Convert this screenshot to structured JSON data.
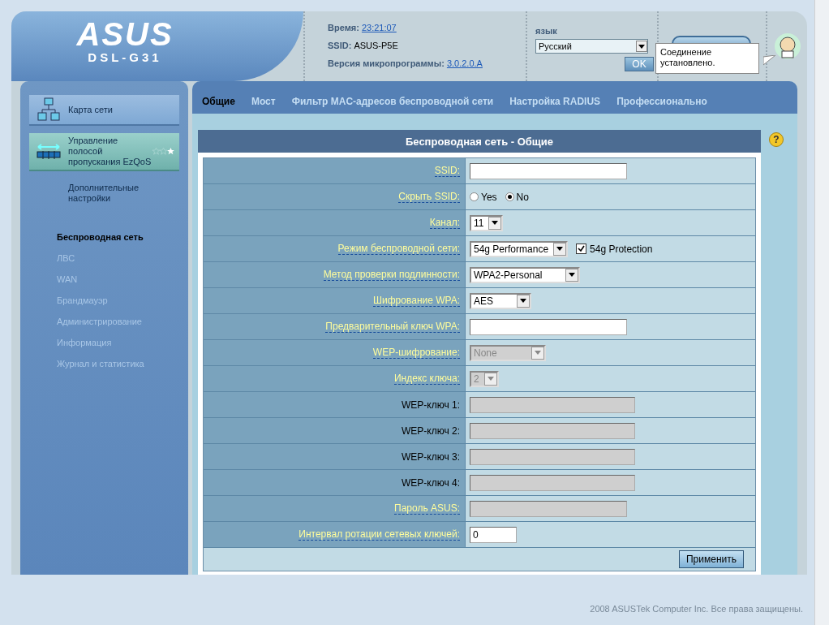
{
  "header": {
    "logo": "ASUS",
    "model": "DSL-G31",
    "time_label": "Время:",
    "time": "23:21:07",
    "ssid_label": "SSID:",
    "ssid": "ASUS-P5E",
    "firmware_label": "Версия микропрограммы:",
    "firmware": "3.0.2.0.A",
    "language_label": "язык",
    "language": "Русский",
    "ok_button": "OK",
    "status_tooltip": "Соединение установлено."
  },
  "sidebar": {
    "items": [
      {
        "label": "Карта сети",
        "kind": "network",
        "selected": false
      },
      {
        "label": "Управление полосой пропускания EzQoS",
        "kind": "qos",
        "selected": true,
        "stars": 1
      },
      {
        "label": "Дополнительные настройки",
        "kind": "plain",
        "selected": false
      }
    ],
    "submenu": [
      {
        "label": "Беспроводная сеть",
        "selected": true
      },
      {
        "label": "ЛВС",
        "selected": false
      },
      {
        "label": "WAN",
        "selected": false
      },
      {
        "label": "Брандмауэр",
        "selected": false
      },
      {
        "label": "Администрирование",
        "selected": false
      },
      {
        "label": "Информация",
        "selected": false
      },
      {
        "label": "Журнал и статистика",
        "selected": false
      }
    ]
  },
  "tabs": [
    {
      "label": "Общие",
      "selected": true
    },
    {
      "label": "Мост",
      "selected": false
    },
    {
      "label": "Фильтр MAC-адресов беспроводной сети",
      "selected": false
    },
    {
      "label": "Настройка RADIUS",
      "selected": false
    },
    {
      "label": "Профессионально",
      "selected": false
    }
  ],
  "help": "?",
  "form": {
    "title": "Беспроводная сеть - Общие",
    "rows": [
      {
        "label": "SSID:",
        "help": true,
        "kind": "text",
        "disabled": false
      },
      {
        "label": "Скрыть SSID:",
        "help": true,
        "kind": "radio",
        "options": [
          {
            "label": "Yes",
            "selected": false
          },
          {
            "label": "No",
            "selected": true
          }
        ]
      },
      {
        "label": "Канал:",
        "help": true,
        "kind": "select",
        "value": "11",
        "disabled": false
      },
      {
        "label": "Режим беспроводной сети:",
        "help": true,
        "kind": "select",
        "value": "54g Performance",
        "disabled": false,
        "checkbox": {
          "label": "54g Protection",
          "checked": true
        }
      },
      {
        "label": "Метод проверки подлинности:",
        "help": true,
        "kind": "select",
        "value": "WPA2-Personal",
        "disabled": false
      },
      {
        "label": "Шифрование WPA:",
        "help": true,
        "kind": "select",
        "value": "AES",
        "disabled": false
      },
      {
        "label": "Предварительный ключ WPA:",
        "help": true,
        "kind": "text",
        "disabled": false
      },
      {
        "label": "WEP-шифрование:",
        "help": true,
        "kind": "select",
        "value": "None",
        "disabled": true
      },
      {
        "label": "Индекс ключа:",
        "help": true,
        "kind": "select",
        "value": "2",
        "disabled": true
      },
      {
        "label": "WEP-ключ 1:",
        "help": false,
        "kind": "text",
        "disabled": true
      },
      {
        "label": "WEP-ключ 2:",
        "help": false,
        "kind": "text",
        "disabled": true
      },
      {
        "label": "WEP-ключ 3:",
        "help": false,
        "kind": "text",
        "disabled": true
      },
      {
        "label": "WEP-ключ 4:",
        "help": false,
        "kind": "text",
        "disabled": true
      },
      {
        "label": "Пароль ASUS:",
        "help": true,
        "kind": "text",
        "disabled": true
      },
      {
        "label": "Интервал ротации сетевых ключей:",
        "help": true,
        "kind": "text",
        "value": "0",
        "disabled": false
      }
    ],
    "apply_button": "Применить"
  },
  "footer": "2008 ASUSTek Computer Inc. Все права защищены."
}
